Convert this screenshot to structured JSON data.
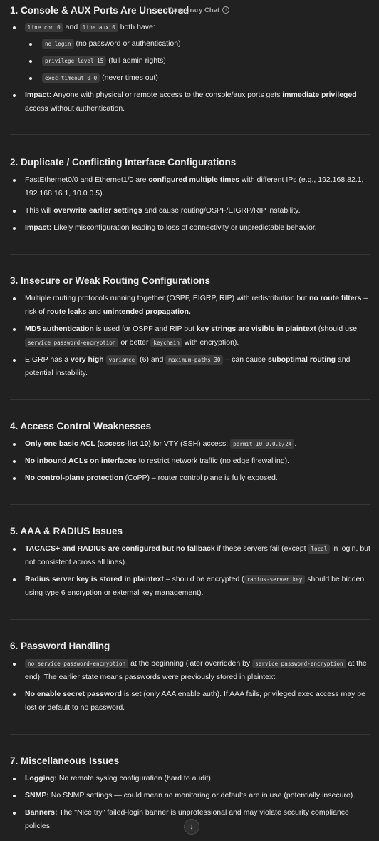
{
  "topbar": {
    "label": "Temporary Chat",
    "info_icon": "info-icon"
  },
  "s1": {
    "title": "1. Console & AUX Ports Are Unsecured",
    "b1_code1": "line con 0",
    "b1_t1": " and ",
    "b1_code2": "line aux 0",
    "b1_t2": " both have:",
    "sub1_code": "no login",
    "sub1_t": " (no password or authentication)",
    "sub2_code": "privilege level 15",
    "sub2_t": " (full admin rights)",
    "sub3_code": "exec-timeout 0 0",
    "sub3_t": " (never times out)",
    "b2_bold1": "Impact:",
    "b2_t1": " Anyone with physical or remote access to the console/aux ports gets ",
    "b2_bold2": "immediate privileged",
    "b2_t2": " access without authentication."
  },
  "s2": {
    "title": "2. Duplicate / Conflicting Interface Configurations",
    "b1_t1": "FastEthernet0/0 and Ethernet1/0 are ",
    "b1_bold": "configured multiple times",
    "b1_t2": " with different IPs (e.g., 192.168.82.1, 192.168.16.1, 10.0.0.5).",
    "b2_t1": "This will ",
    "b2_bold": "overwrite earlier settings",
    "b2_t2": " and cause routing/OSPF/EIGRP/RIP instability.",
    "b3_bold": "Impact:",
    "b3_t": " Likely misconfiguration leading to loss of connectivity or unpredictable behavior."
  },
  "s3": {
    "title": "3. Insecure or Weak Routing Configurations",
    "b1_t1": "Multiple routing protocols running together (OSPF, EIGRP, RIP) with redistribution but ",
    "b1_bold1": "no route filters",
    "b1_t2": " – risk of ",
    "b1_bold2": "route leaks",
    "b1_t3": " and ",
    "b1_bold3": "unintended propagation.",
    "b2_bold1": "MD5 authentication",
    "b2_t1": " is used for OSPF and RIP but ",
    "b2_bold2": "key strings are visible in plaintext",
    "b2_t2": " (should use ",
    "b2_code1": "service password-encryption",
    "b2_t3": " or better ",
    "b2_code2": "keychain",
    "b2_t4": " with encryption).",
    "b3_t1": "EIGRP has a ",
    "b3_bold1": "very high",
    "b3_code1": "variance",
    "b3_t2": " (6) and ",
    "b3_code2": "maximum-paths 30",
    "b3_t3": " – can cause ",
    "b3_bold2": "suboptimal routing",
    "b3_t4": " and potential instability."
  },
  "s4": {
    "title": "4. Access Control Weaknesses",
    "b1_bold": "Only one basic ACL (access-list 10)",
    "b1_t": " for VTY (SSH) access: ",
    "b1_code": "permit 10.0.0.0/24",
    "b1_end": ".",
    "b2_bold": "No inbound ACLs on interfaces",
    "b2_t": " to restrict network traffic (no edge firewalling).",
    "b3_bold": "No control-plane protection",
    "b3_t": " (CoPP) – router control plane is fully exposed."
  },
  "s5": {
    "title": "5. AAA & RADIUS Issues",
    "b1_bold1": "TACACS+ and RADIUS are configured but no fallback",
    "b1_t1": " if these servers fail (except ",
    "b1_code": "local",
    "b1_t2": " in login, but not consistent across all lines).",
    "b2_bold": "Radius server key is stored in plaintext",
    "b2_t1": " – should be encrypted (",
    "b2_code": "radius-server key",
    "b2_t2": " should be hidden using type 6 encryption or external key management)."
  },
  "s6": {
    "title": "6. Password Handling",
    "b1_code1": "no service password-encryption",
    "b1_t1": " at the beginning (later overridden by ",
    "b1_code2": "service password-encryption",
    "b1_t2": " at the end). The earlier state means passwords were previously stored in plaintext.",
    "b2_bold": "No enable secret password",
    "b2_t": " is set (only AAA enable auth). If AAA fails, privileged exec access may be lost or default to no password."
  },
  "s7": {
    "title": "7. Miscellaneous Issues",
    "b1_bold": "Logging:",
    "b1_t": " No remote syslog configuration (hard to audit).",
    "b2_bold": "SNMP:",
    "b2_t": " No SNMP settings — could mean no monitoring or defaults are in use (potentially insecure).",
    "b3_bold": "Banners:",
    "b3_t": " The \"Nice try\" failed-login banner is unprofessional and may violate security compliance policies."
  },
  "scroll_button": {
    "icon": "arrow-down-icon",
    "glyph": "↓"
  }
}
